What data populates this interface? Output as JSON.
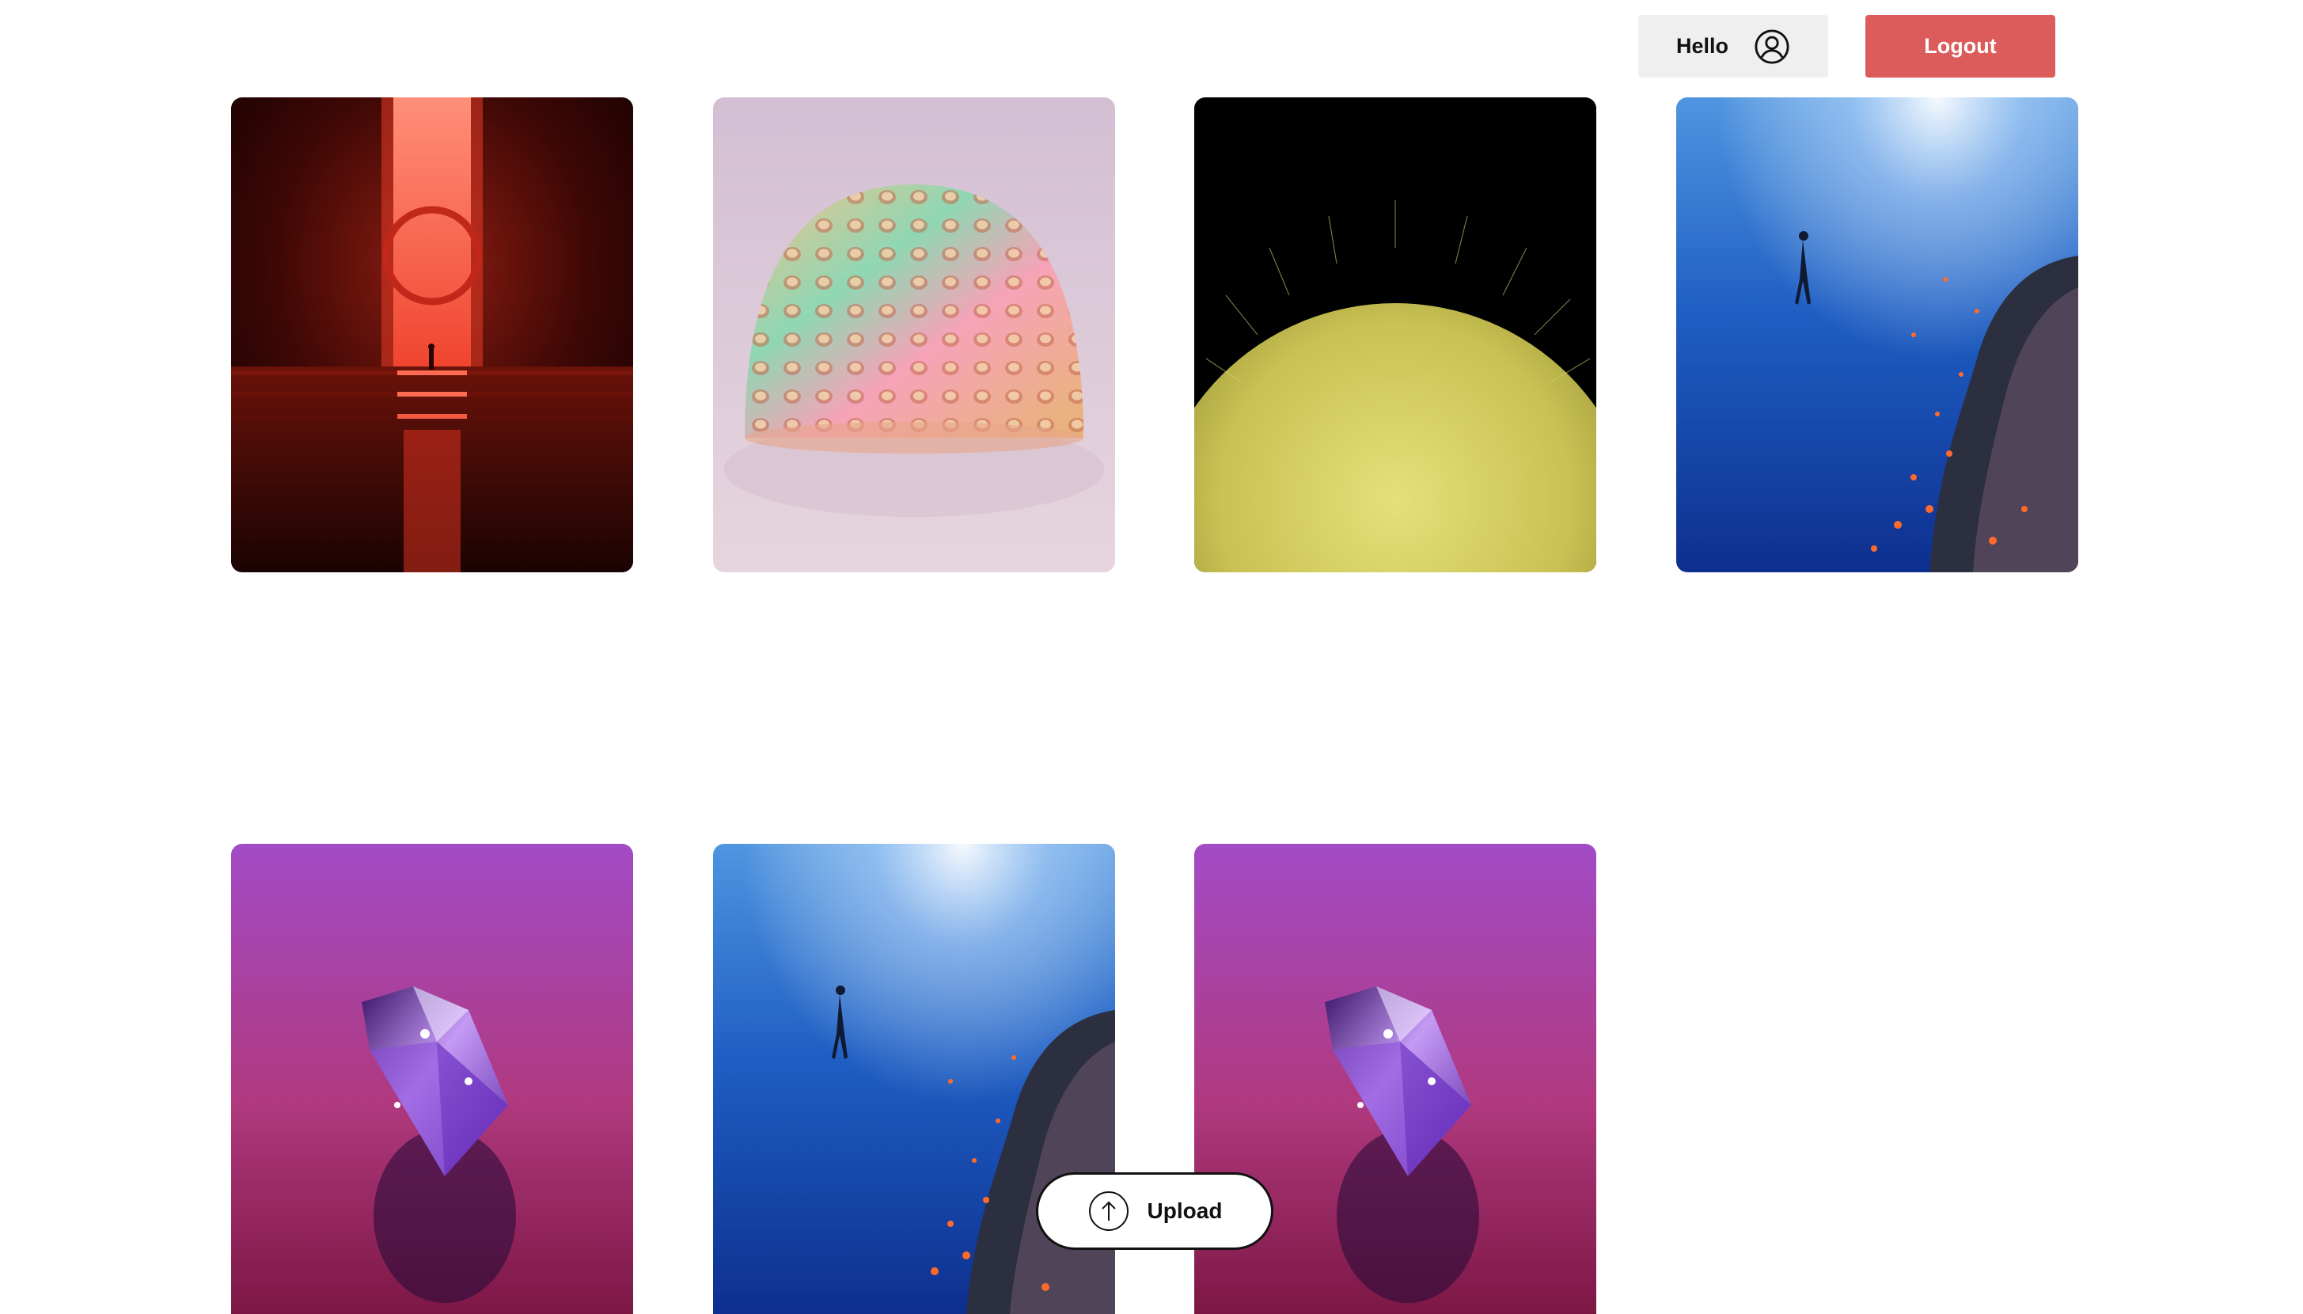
{
  "header": {
    "greeting_label": "Hello",
    "user_icon": "user-circle-icon",
    "logout_label": "Logout"
  },
  "gallery": {
    "items": [
      {
        "subject": "red-portal-image"
      },
      {
        "subject": "iridescent-dome-image"
      },
      {
        "subject": "yellow-fur-sphere-image"
      },
      {
        "subject": "underwater-diver-image"
      },
      {
        "subject": "purple-diamond-image"
      },
      {
        "subject": "underwater-diver-image"
      },
      {
        "subject": "purple-diamond-image"
      }
    ]
  },
  "upload": {
    "label": "Upload",
    "icon": "arrow-up-circle-icon"
  },
  "colors": {
    "logout_bg": "#dc5c5b",
    "hello_bg": "#efefef"
  }
}
